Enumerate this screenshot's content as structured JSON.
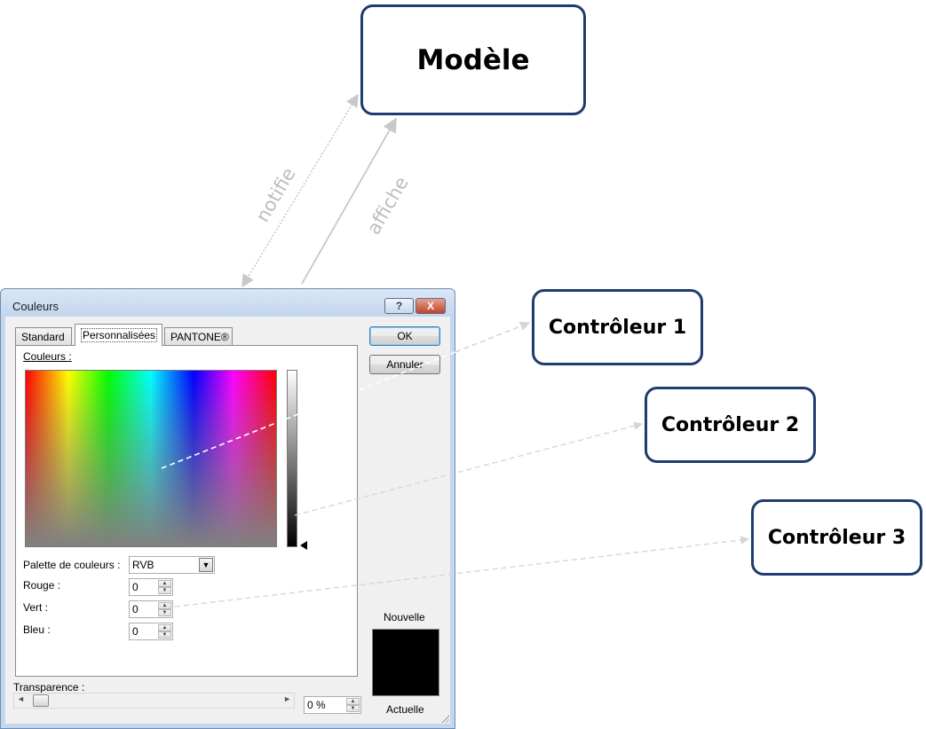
{
  "diagram": {
    "model_label": "Modèle",
    "controller1_label": "Contrôleur 1",
    "controller2_label": "Contrôleur 2",
    "controller3_label": "Contrôleur 3",
    "notifie_label": "notifie",
    "affiche_label": "affiche",
    "box_border_color": "#1f3c6e",
    "arrow_color": "#c8c8c8"
  },
  "dialog": {
    "title": "Couleurs",
    "help_label": "?",
    "close_label": "X",
    "tabs": [
      "Standard",
      "Personnalisées",
      "PANTONE®"
    ],
    "active_tab": "Personnalisées",
    "colors_label": "Couleurs :",
    "palette_label": "Palette de couleurs :",
    "palette_value": "RVB",
    "rouge_label": "Rouge :",
    "rouge_value": "0",
    "vert_label": "Vert :",
    "vert_value": "0",
    "bleu_label": "Bleu :",
    "bleu_value": "0",
    "ok_label": "OK",
    "cancel_label": "Annuler",
    "nouvelle_label": "Nouvelle",
    "actuelle_label": "Actuelle",
    "preview_color": "#000000",
    "transparence_label": "Transparence :",
    "transparence_value": "0 %",
    "transparence_level": 0
  }
}
